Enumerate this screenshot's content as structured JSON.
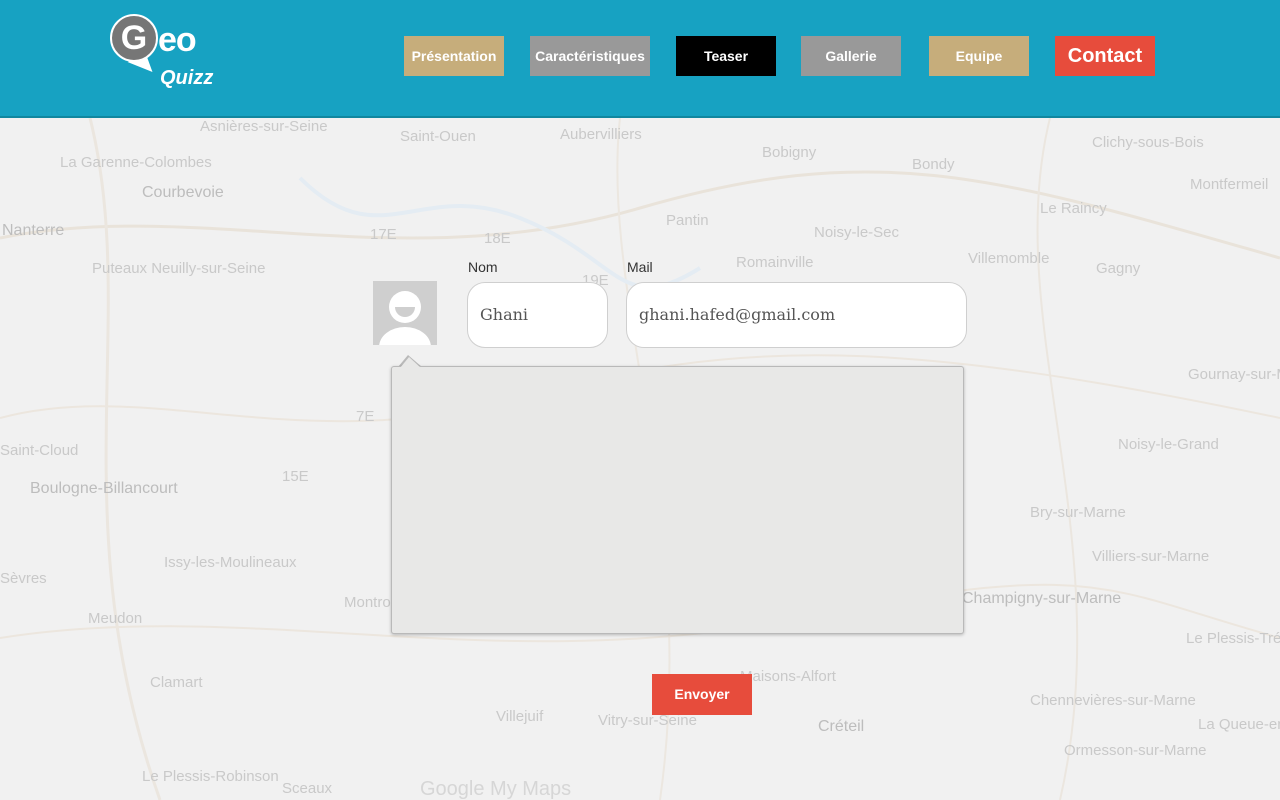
{
  "logo": {
    "g": "G",
    "eo": "eo",
    "quizz": "Quizz"
  },
  "nav": {
    "presentation": "Présentation",
    "caracteristiques": "Caractéristiques",
    "teaser": "Teaser",
    "gallerie": "Gallerie",
    "equipe": "Equipe",
    "contact": "Contact"
  },
  "map": {
    "labels": [
      "Asnières-sur-Seine",
      "Saint-Ouen",
      "Aubervilliers",
      "Bobigny",
      "Bondy",
      "Clichy-sous-Bois",
      "La Garenne-Colombes",
      "Courbevoie",
      "Montfermeil",
      "Nanterre",
      "Pantin",
      "Noisy-le-Sec",
      "Le Raincy",
      "Puteaux Neuilly-sur-Seine",
      "Romainville",
      "Villemomble",
      "Gagny",
      "Gournay-sur-Marne",
      "Noisy-le-Grand",
      "Boulogne-Billancourt",
      "Saint-Cloud",
      "Issy-les-Moulineaux",
      "Sèvres",
      "Meudon",
      "Montrouge",
      "Champigny-sur-Marne",
      "Villiers-sur-Marne",
      "Bry-sur-Marne",
      "Clamart",
      "Maisons-Alfort",
      "Villejuif",
      "Vitry-sur-Seine",
      "Créteil",
      "Chennevières-sur-Marne",
      "Le Plessis-Robinson",
      "Sceaux",
      "Ormesson-sur-Marne",
      "Le Plessis-Trévise",
      "La Queue-en-Brie",
      "17E",
      "18E",
      "19E",
      "7E",
      "15E"
    ],
    "brand": "Google My Maps"
  },
  "form": {
    "nom_label": "Nom",
    "mail_label": "Mail",
    "nom_value": "Ghani",
    "mail_value": "ghani.hafed@gmail.com",
    "message_value": "",
    "send_label": "Envoyer"
  },
  "colors": {
    "header": "#17a2c2",
    "tan": "#c6ad7b",
    "gray": "#999999",
    "black": "#000000",
    "red": "#e74c3c"
  }
}
